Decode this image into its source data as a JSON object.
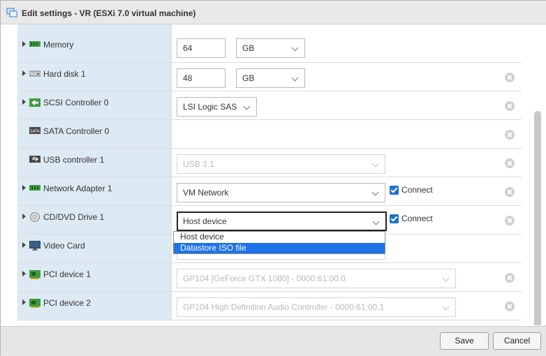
{
  "dialog": {
    "title": "Edit settings - VR (ESXi 7.0 virtual machine)"
  },
  "rows": [
    {
      "label": "Memory",
      "value": "64",
      "unit": "GB",
      "icon": "memory-icon",
      "expandable": true
    },
    {
      "label": "Hard disk 1",
      "value": "48",
      "unit": "GB",
      "icon": "hard-disk-icon",
      "expandable": true,
      "removable": true
    },
    {
      "label": "SCSI Controller 0",
      "select": "LSI Logic SAS",
      "icon": "scsi-controller-icon",
      "expandable": true,
      "removable": true
    },
    {
      "label": "SATA Controller 0",
      "icon": "sata-controller-icon",
      "expandable": false,
      "removable": true
    },
    {
      "label": "USB controller 1",
      "select": "USB 3.1",
      "disabled": true,
      "icon": "usb-icon",
      "expandable": false,
      "removable": true
    },
    {
      "label": "Network Adapter 1",
      "select": "VM Network",
      "connect_label": "Connect",
      "connected": true,
      "icon": "network-adapter-icon",
      "expandable": true,
      "removable": true
    },
    {
      "label": "CD/DVD Drive 1",
      "select": "Host device",
      "connect_label": "Connect",
      "connected": true,
      "icon": "cd-dvd-icon",
      "expandable": true,
      "removable": true
    },
    {
      "label": "Video Card",
      "icon": "monitor-icon",
      "expandable": true
    },
    {
      "label": "PCI device 1",
      "select": "GP104 [GeForce GTX 1080] - 0000:61:00.0",
      "disabled": true,
      "icon": "pci-device-icon",
      "expandable": true,
      "removable": true
    },
    {
      "label": "PCI device 2",
      "select": "GP104 High Definition Audio Controller - 0000:61:00.1",
      "disabled": true,
      "icon": "pci-device-icon",
      "expandable": true,
      "removable": true
    }
  ],
  "cd_dropdown": {
    "options": [
      "Host device",
      "Datastore ISO file"
    ],
    "highlighted": "Datastore ISO file"
  },
  "footer": {
    "save_label": "Save",
    "cancel_label": "Cancel"
  },
  "colors": {
    "label_bg": "#dde9f3",
    "highlight": "#1e73e8",
    "checkbox": "#1c73cf"
  }
}
